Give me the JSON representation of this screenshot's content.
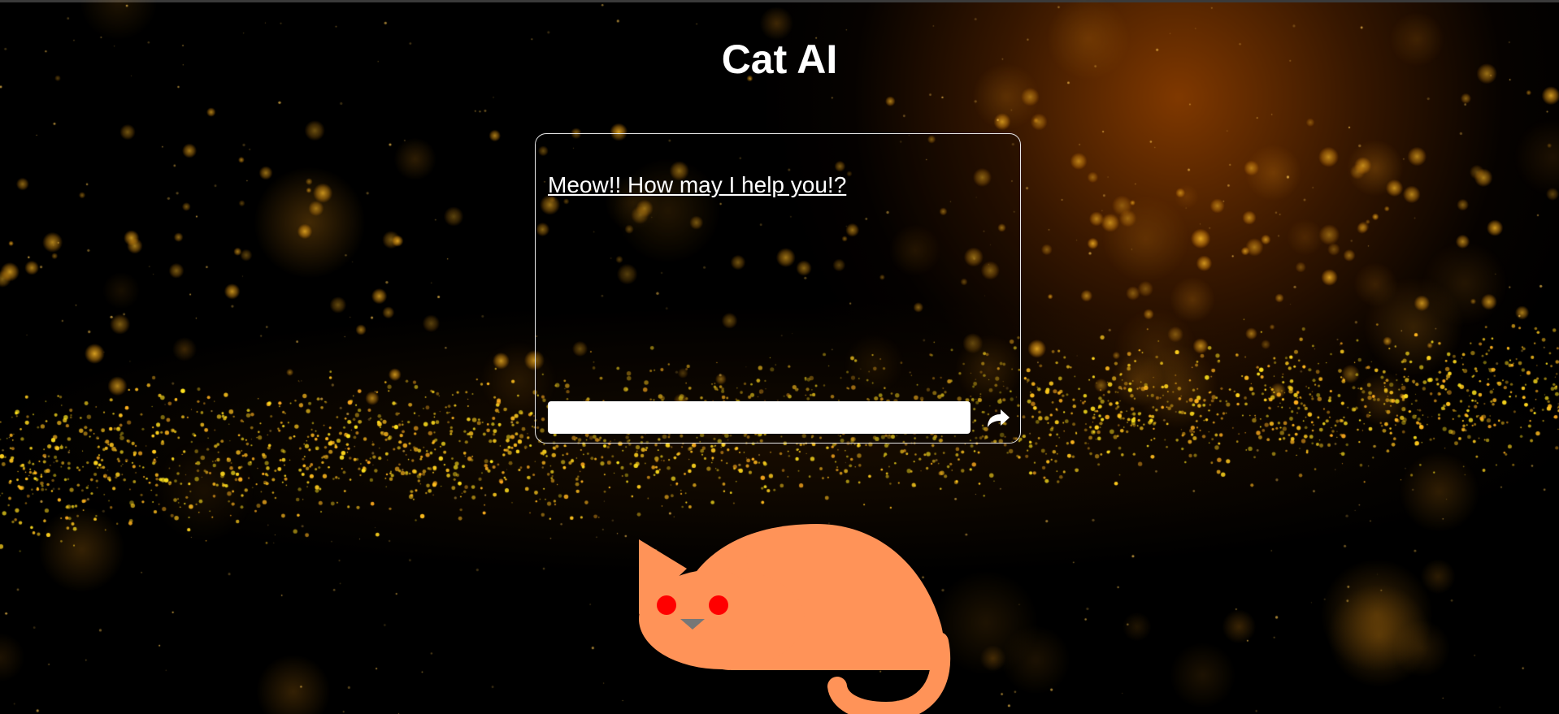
{
  "page": {
    "title": "Cat AI"
  },
  "chat": {
    "message": "Meow!! How may I help you!?",
    "input_value": "",
    "input_placeholder": "",
    "send_icon": "share-arrow-icon"
  },
  "cat": {
    "icon": "cat-illustration",
    "body_color": "#ff9358",
    "eye_color": "#ff0000",
    "nose_color": "#777777"
  },
  "theme": {
    "background": "#000000",
    "glow_color": "#b34f00",
    "particle_color": "#ffb300",
    "panel_border": "#e8e8e8"
  }
}
